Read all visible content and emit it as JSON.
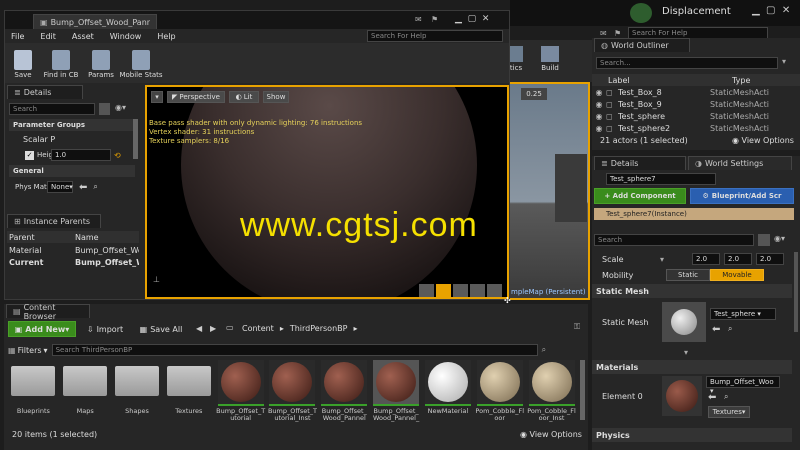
{
  "bg_window": {
    "displacement_label": "Displacement",
    "search_placeholder": "Search For Help",
    "toolbar": {
      "statistics": "tics",
      "build": "Build",
      "value": "0.25"
    },
    "viewport_label": "mpleMap (Persistent)"
  },
  "world_outliner": {
    "tab": "World Outliner",
    "search_placeholder": "Search...",
    "col_label": "Label",
    "col_type": "Type",
    "rows": [
      {
        "label": "Test_Box_8",
        "type": "StaticMeshActi"
      },
      {
        "label": "Test_Box_9",
        "type": "StaticMeshActi"
      },
      {
        "label": "Test_sphere",
        "type": "StaticMeshActi"
      },
      {
        "label": "Test_sphere2",
        "type": "StaticMeshActi"
      }
    ],
    "status": "21 actors (1 selected)",
    "view_options": "View Options"
  },
  "right_details": {
    "tab": "Details",
    "tab2": "World Settings",
    "name_value": "Test_sphere7",
    "add_component": "+ Add Component",
    "blueprint": "Blueprint/Add Scr",
    "instance": "Test_sphere7(Instance)",
    "search_placeholder": "Search",
    "scale_label": "Scale",
    "scale_values": [
      "2.0",
      "2.0",
      "2.0"
    ],
    "mobility_label": "Mobility",
    "mobility_static": "Static",
    "mobility_movable": "Movable",
    "static_mesh_section": "Static Mesh",
    "static_mesh_label": "Static Mesh",
    "static_mesh_value": "Test_sphere",
    "materials_section": "Materials",
    "element_label": "Element 0",
    "element_value": "Bump_Offset_Woo",
    "textures_btn": "Textures",
    "physics_section": "Physics"
  },
  "editor": {
    "tab_title": "Bump_Offset_Wood_Pann",
    "menu": [
      "File",
      "Edit",
      "Asset",
      "Window",
      "Help"
    ],
    "search_placeholder": "Search For Help",
    "toolbar": [
      "Save",
      "Find in CB",
      "Params",
      "Mobile Stats"
    ],
    "details_tab": "Details",
    "details_search": "Search",
    "param_groups": "Parameter Groups",
    "scalar_p": "Scalar P",
    "height_label": "Heig",
    "height_value": "1.0",
    "general": "General",
    "phys_mat_label": "Phys Mat",
    "phys_mat_value": "None",
    "instance_parents_tab": "Instance Parents",
    "ip_col_parent": "Parent",
    "ip_col_name": "Name",
    "ip_rows": [
      {
        "parent": "Material",
        "name": "Bump_Offset_Wood"
      },
      {
        "parent": "Current",
        "name": "Bump_Offset_Wood"
      }
    ],
    "viewport_perspective": "Perspective",
    "viewport_lit": "Lit",
    "viewport_show": "Show",
    "stats_lines": [
      "Base pass shader with only dynamic lighting: 76 instructions",
      "Vertex shader: 31 instructions",
      "Texture samplers: 8/16"
    ]
  },
  "watermark": "www.cgtsj.com",
  "content_browser": {
    "tab": "Content Browser",
    "add_new": "Add New",
    "import": "Import",
    "save_all": "Save All",
    "path": [
      "Content",
      "ThirdPersonBP"
    ],
    "filters": "Filters",
    "search_placeholder": "Search ThirdPersonBP",
    "items": [
      {
        "name": "Blueprints",
        "kind": "folder"
      },
      {
        "name": "Maps",
        "kind": "folder"
      },
      {
        "name": "Shapes",
        "kind": "folder"
      },
      {
        "name": "Textures",
        "kind": "folder"
      },
      {
        "name": "Bump_Offset_Tutorial",
        "kind": "wood"
      },
      {
        "name": "Bump_Offset_Tutorial_Inst",
        "kind": "wood"
      },
      {
        "name": "Bump_Offset_Wood_Pannel",
        "kind": "wood"
      },
      {
        "name": "Bump_Offset_Wood_Pannel_",
        "kind": "wood"
      },
      {
        "name": "NewMaterial",
        "kind": "white"
      },
      {
        "name": "Pom_Cobble_Floor",
        "kind": "cobble"
      },
      {
        "name": "Pom_Cobble_Floor_Inst",
        "kind": "cobble"
      }
    ],
    "status": "20 items (1 selected)",
    "view_options": "View Options"
  },
  "colors": {
    "accent_orange": "#e8a200",
    "green_button": "#3a8c1c",
    "blue_button": "#2a5fb0",
    "watermark": "#f5e000",
    "selected_row": "#e8a200"
  }
}
